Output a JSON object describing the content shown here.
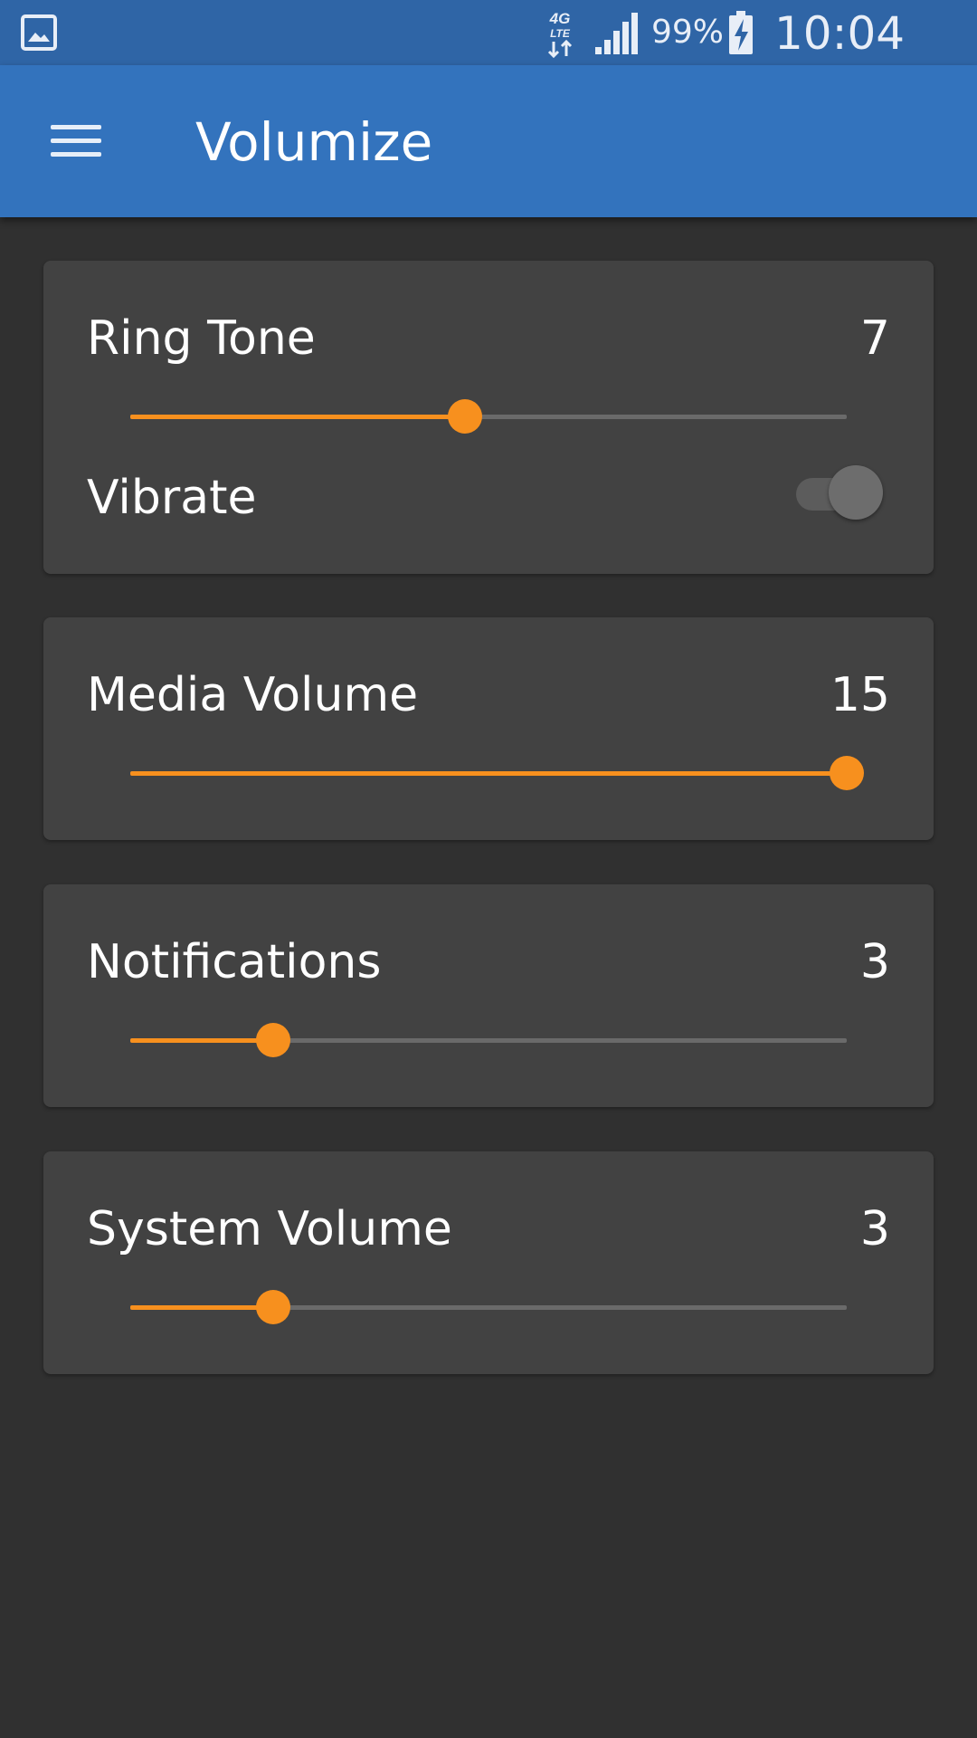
{
  "status_bar": {
    "network": "4G LTE",
    "battery": "99%",
    "time": "10:04 AM"
  },
  "app_bar": {
    "title": "Volumize"
  },
  "controls": [
    {
      "label": "Ring Tone",
      "value": "7",
      "level": 7,
      "max": 15
    },
    {
      "label": "Media Volume",
      "value": "15",
      "level": 15,
      "max": 15
    },
    {
      "label": "Notifications",
      "value": "3",
      "level": 3,
      "max": 15
    },
    {
      "label": "System Volume",
      "value": "3",
      "level": 3,
      "max": 15
    }
  ],
  "vibrate": {
    "label": "Vibrate",
    "on": false
  },
  "colors": {
    "accent": "#f7901e",
    "app_bar": "#3373bd",
    "status_bar": "#2f65a6",
    "background": "#303030",
    "card": "#424242"
  }
}
